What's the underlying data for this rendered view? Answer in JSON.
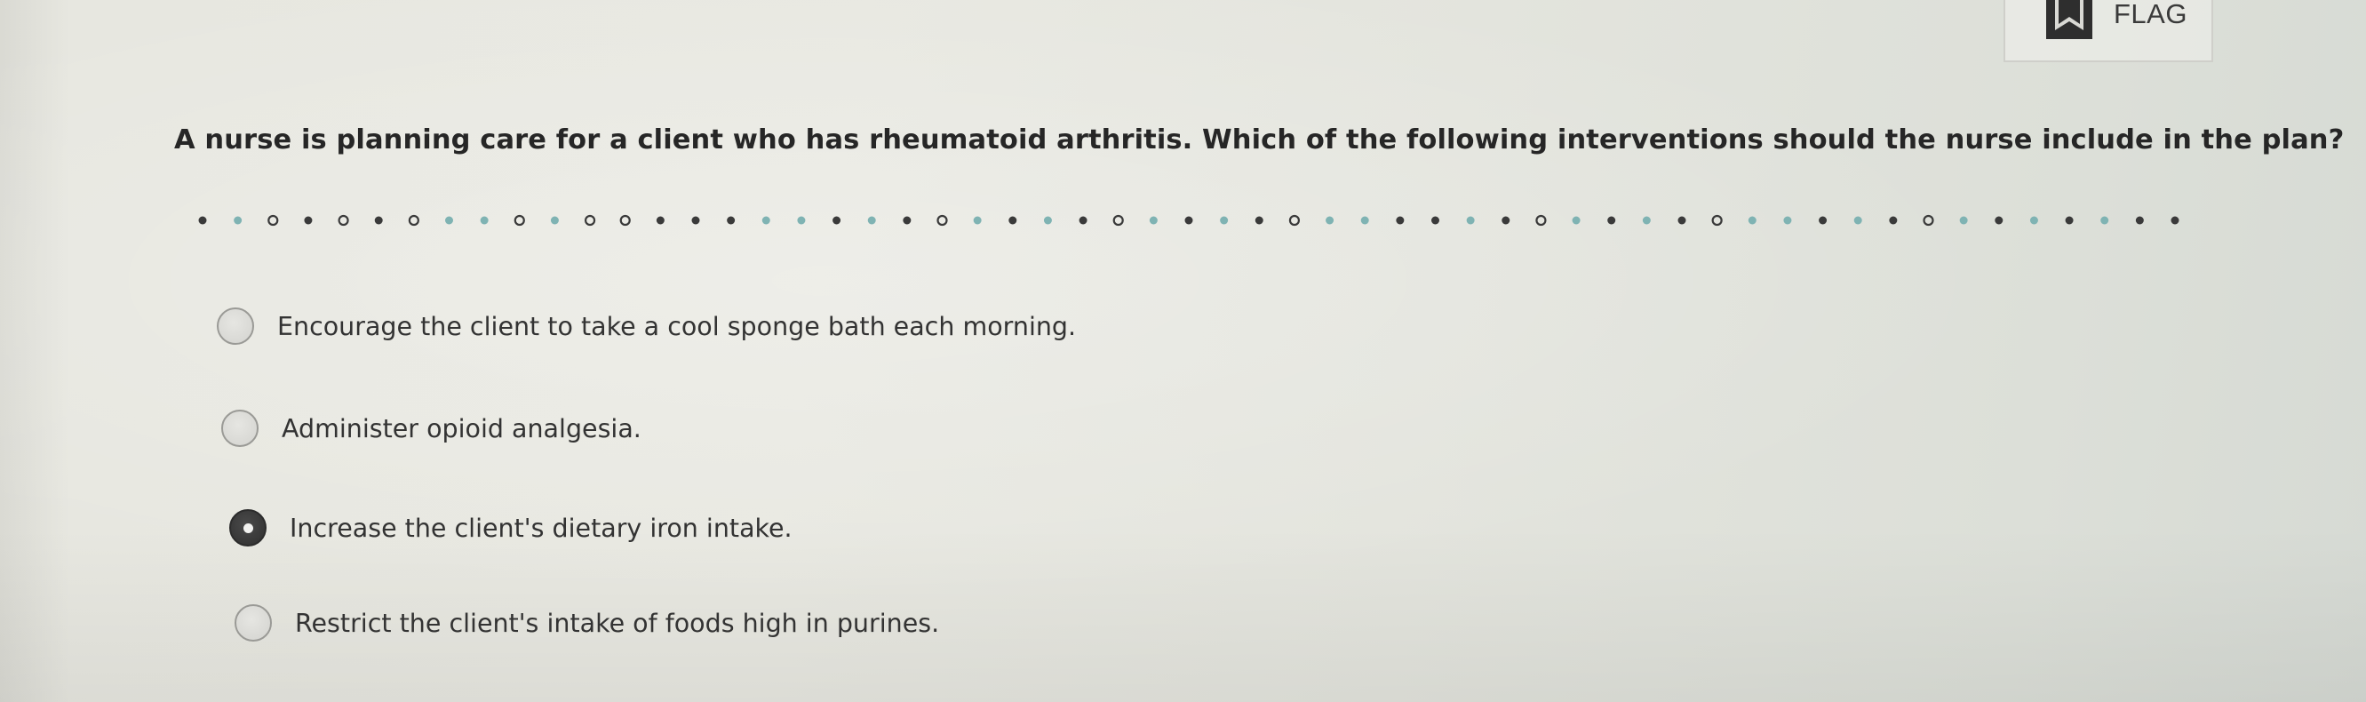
{
  "flag": {
    "label": "FLAG",
    "icon": "bookmark-flag-icon"
  },
  "question": {
    "text": "A nurse is planning care for a client who has rheumatoid arthritis. Which of the following interventions should the nurse include in the plan?"
  },
  "options": [
    {
      "text": "Encourage the client to take a cool sponge bath each morning.",
      "selected": false
    },
    {
      "text": "Administer opioid analgesia.",
      "selected": false
    },
    {
      "text": "Increase the client's dietary iron intake.",
      "selected": true
    },
    {
      "text": "Restrict the client's intake of foods high in purines.",
      "selected": false
    }
  ],
  "colors": {
    "background": "#e6e6df",
    "text": "#2b2b2b",
    "radio_selected": "#333333",
    "dot_teal": "#7fb3b3",
    "dot_dark": "#3a3a3a"
  }
}
